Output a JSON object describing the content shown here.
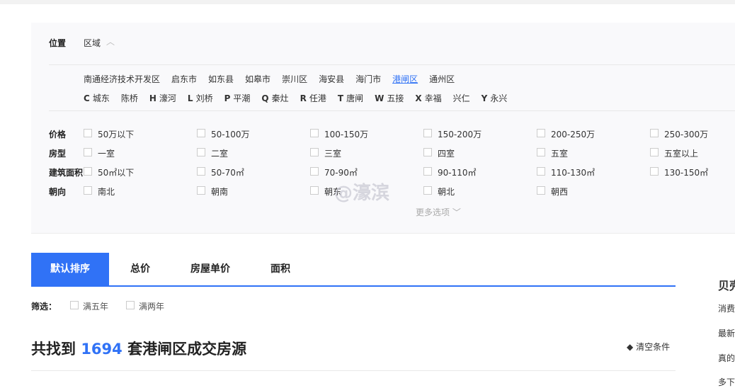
{
  "location": {
    "label": "位置",
    "mode": "区域",
    "districts": [
      "南通经济技术开发区",
      "启东市",
      "如东县",
      "如皋市",
      "崇川区",
      "海安县",
      "海门市",
      "港闸区",
      "通州区"
    ],
    "selected_district": "港闸区",
    "areas": [
      {
        "letter": "C",
        "name": "城东"
      },
      {
        "letter": "",
        "name": "陈桥"
      },
      {
        "letter": "H",
        "name": "濠河"
      },
      {
        "letter": "L",
        "name": "刘桥"
      },
      {
        "letter": "P",
        "name": "平潮"
      },
      {
        "letter": "Q",
        "name": "秦灶"
      },
      {
        "letter": "R",
        "name": "任港"
      },
      {
        "letter": "T",
        "name": "唐闸"
      },
      {
        "letter": "W",
        "name": "五接"
      },
      {
        "letter": "X",
        "name": "幸福"
      },
      {
        "letter": "",
        "name": "兴仁"
      },
      {
        "letter": "Y",
        "name": "永兴"
      }
    ]
  },
  "filters": [
    {
      "label": "价格",
      "options": [
        "50万以下",
        "50-100万",
        "100-150万",
        "150-200万",
        "200-250万",
        "250-300万"
      ]
    },
    {
      "label": "房型",
      "options": [
        "一室",
        "二室",
        "三室",
        "四室",
        "五室",
        "五室以上"
      ]
    },
    {
      "label": "建筑面积",
      "options": [
        "50㎡以下",
        "50-70㎡",
        "70-90㎡",
        "90-110㎡",
        "110-130㎡",
        "130-150㎡"
      ]
    },
    {
      "label": "朝向",
      "options": [
        "南北",
        "朝南",
        "朝东",
        "朝北",
        "朝西"
      ]
    }
  ],
  "more_options": "更多选项",
  "watermark": "@濠滨",
  "sort_tabs": [
    "默认排序",
    "总价",
    "房屋单价",
    "面积"
  ],
  "screen": {
    "label": "筛选：",
    "options": [
      "满五年",
      "满两年"
    ]
  },
  "result": {
    "prefix": "共找到",
    "count": "1694",
    "suffix": "套港闸区成交房源"
  },
  "clear": "清空条件",
  "sidebar": {
    "title": "贝壳",
    "items": [
      "消费",
      "最新",
      "真的",
      "多下"
    ]
  },
  "colors": {
    "accent": "#3072f6"
  }
}
